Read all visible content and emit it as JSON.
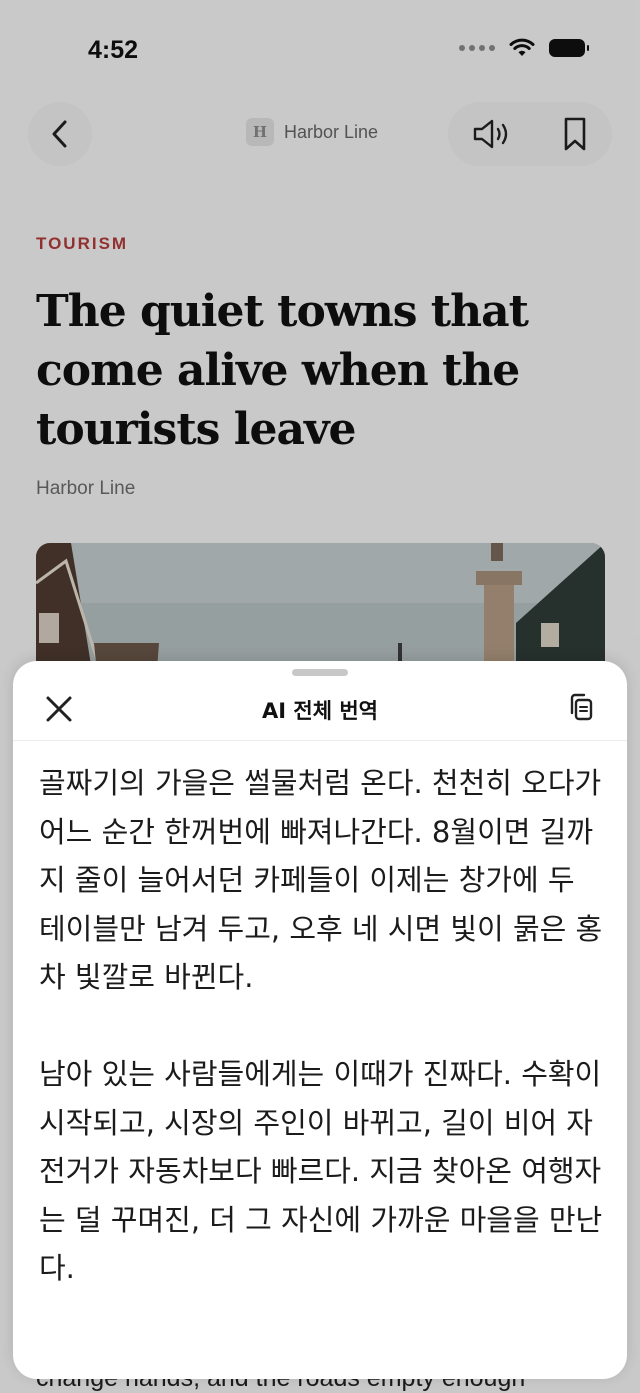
{
  "status_bar": {
    "time": "4:52"
  },
  "nav": {
    "source_logo_letter": "H",
    "source_name": "Harbor Line"
  },
  "article": {
    "category": "TOURISM",
    "headline": "The quiet towns that come alive when the tourists leave",
    "byline": "Harbor Line",
    "peek_text": "change hands, and the roads empty enough"
  },
  "sheet": {
    "title": "AI 전체 번역",
    "paragraphs": [
      "골짜기의 가을은 썰물처럼 온다. 천천히 오다가 어느 순간 한꺼번에 빠져나간다. 8월이면 길까지 줄이 늘어서던 카페들이 이제는 창가에 두 테이블만 남겨 두고, 오후 네 시면 빛이 묽은 홍차 빛깔로 바뀐다.",
      "남아 있는 사람들에게는 이때가 진짜다. 수확이 시작되고, 시장의 주인이 바뀌고, 길이 비어 자전거가 자동차보다 빠르다. 지금 찾아온 여행자는 덜 꾸며진, 더 그 자신에 가까운 마을을 만난다."
    ]
  },
  "icons": {
    "back": "chevron-left-icon",
    "listen": "speaker-icon",
    "bookmark": "bookmark-icon",
    "close": "close-icon",
    "copy": "copy-icon"
  }
}
